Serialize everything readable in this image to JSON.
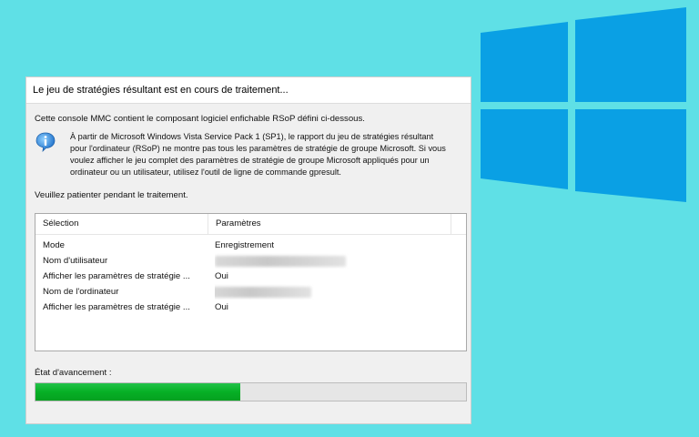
{
  "dialog": {
    "title": "Le jeu de stratégies résultant est en cours de traitement...",
    "intro": "Cette console MMC contient le composant logiciel enfichable RSoP défini ci-dessous.",
    "info_text": "À partir de Microsoft Windows Vista Service Pack 1 (SP1), le rapport du jeu de stratégies résultant pour l'ordinateur (RSoP) ne montre pas tous les paramètres de stratégie de groupe Microsoft. Si vous voulez afficher le jeu complet des paramètres de stratégie de groupe Microsoft appliqués pour un ordinateur ou un utilisateur, utilisez l'outil de ligne de commande gpresult.",
    "wait_text": "Veuillez patienter pendant le traitement."
  },
  "listview": {
    "columns": [
      "Sélection",
      "Paramètres"
    ],
    "rows": [
      {
        "selection": "Mode",
        "value": "Enregistrement",
        "redacted": false
      },
      {
        "selection": "Nom d'utilisateur",
        "value": "",
        "redacted": true
      },
      {
        "selection": "Afficher les paramètres de stratégie ...",
        "value": "Oui",
        "redacted": false
      },
      {
        "selection": "Nom de l'ordinateur",
        "value": "",
        "redacted": true
      },
      {
        "selection": "Afficher les paramètres de stratégie ...",
        "value": "Oui",
        "redacted": false
      }
    ]
  },
  "progress": {
    "label": "État d'avancement :",
    "fraction": 0.475,
    "color": "#06b025"
  },
  "decor": {
    "logo": "windows-logo",
    "logo_color": "#0aa0e4",
    "background_color": "#5fe0e6"
  }
}
